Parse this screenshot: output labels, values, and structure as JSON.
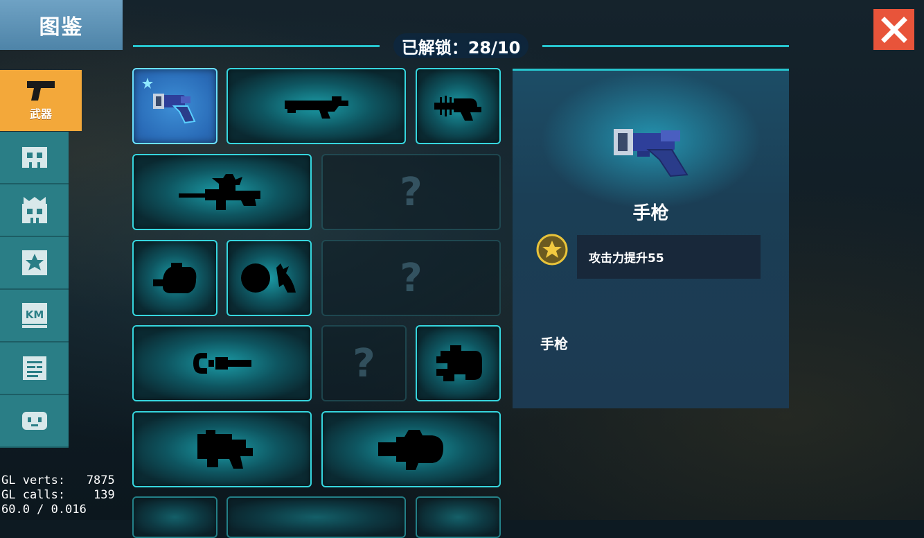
{
  "title": "图鉴",
  "unlocked": "已解锁：28/10",
  "sidebar": {
    "items": [
      {
        "label": "武器",
        "icon": "pistol-icon",
        "active": true
      },
      {
        "label": "",
        "icon": "skull-icon"
      },
      {
        "label": "",
        "icon": "crown-skull-icon"
      },
      {
        "label": "",
        "icon": "star-box-icon"
      },
      {
        "label": "KM",
        "icon": "km-badge-icon"
      },
      {
        "label": "",
        "icon": "document-icon"
      },
      {
        "label": "",
        "icon": "pet-face-icon"
      }
    ]
  },
  "grid": {
    "locked_symbol": "?",
    "cells": [
      {
        "state": "selected",
        "icon": "pistol-icon"
      },
      {
        "state": "silhouette",
        "icon": "rifle-silhouette-icon"
      },
      {
        "state": "silhouette",
        "icon": "ray-gun-silhouette-icon"
      },
      {
        "state": "silhouette",
        "icon": "sniper-silhouette-icon"
      },
      {
        "state": "locked",
        "icon": "question-icon"
      },
      {
        "state": "silhouette",
        "icon": "mace-silhouette-icon"
      },
      {
        "state": "silhouette",
        "icon": "orb-gun-silhouette-icon"
      },
      {
        "state": "locked",
        "icon": "question-icon"
      },
      {
        "state": "silhouette",
        "icon": "chain-saw-silhouette-icon"
      },
      {
        "state": "locked",
        "icon": "question-icon"
      },
      {
        "state": "silhouette",
        "icon": "gatling-silhouette-icon"
      },
      {
        "state": "silhouette",
        "icon": "launcher-silhouette-icon"
      },
      {
        "state": "silhouette",
        "icon": "cannon-silhouette-icon"
      }
    ]
  },
  "detail": {
    "name": "手枪",
    "effect": "攻击力提升55",
    "description": "手枪"
  },
  "debug": {
    "line1": "GL verts:   7875",
    "line2": "GL calls:    139",
    "line3": "60.0 / 0.016"
  },
  "colors": {
    "accent": "#27c6cf",
    "active_tab": "#f3a83a",
    "close": "#e8543a",
    "sidebar": "#2a7e86"
  }
}
